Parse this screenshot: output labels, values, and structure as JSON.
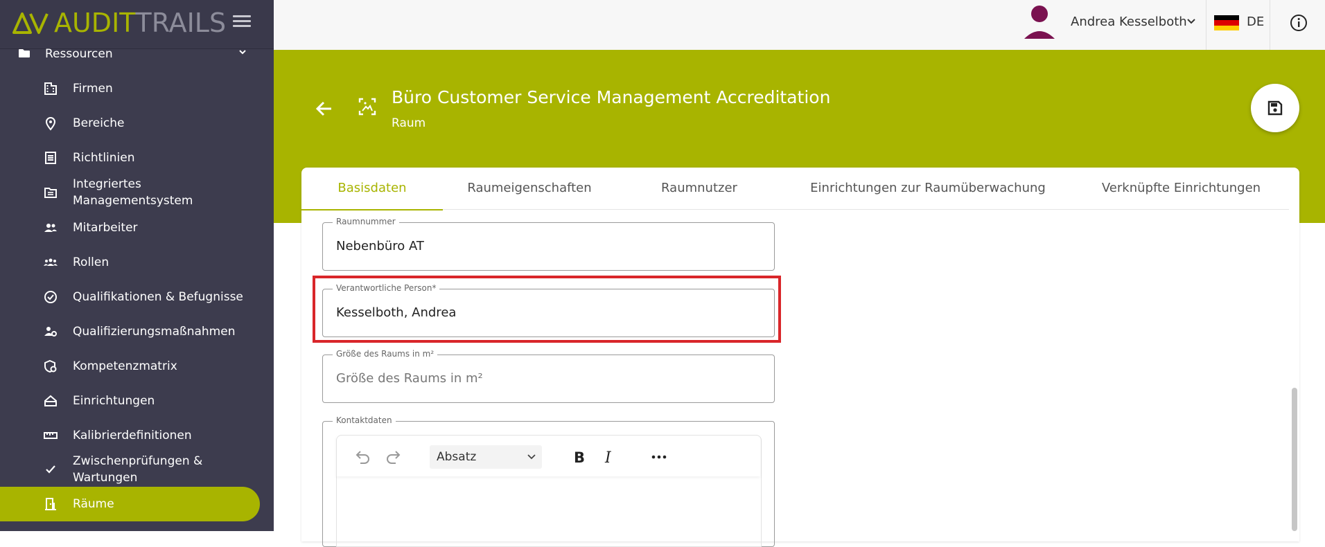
{
  "app": {
    "logo_part1": "AUDIT",
    "logo_part2": "TRAILS",
    "brand_color": "#a8b400",
    "sidebar_color": "#3d3c4e"
  },
  "sidebar": {
    "group": {
      "label": "Ressourcen",
      "icon": "folder-icon"
    },
    "items": [
      {
        "label": "Firmen",
        "icon": "building-icon"
      },
      {
        "label": "Bereiche",
        "icon": "location-pin-icon"
      },
      {
        "label": "Richtlinien",
        "icon": "document-list-icon"
      },
      {
        "label": "Integriertes Managementsystem",
        "icon": "folder-list-icon"
      },
      {
        "label": "Mitarbeiter",
        "icon": "people-icon"
      },
      {
        "label": "Rollen",
        "icon": "groups-icon"
      },
      {
        "label": "Qualifikationen & Befugnisse",
        "icon": "verified-badge-icon"
      },
      {
        "label": "Qualifizierungsmaßnahmen",
        "icon": "person-settings-icon"
      },
      {
        "label": "Kompetenzmatrix",
        "icon": "shield-matrix-icon"
      },
      {
        "label": "Einrichtungen",
        "icon": "house-icon"
      },
      {
        "label": "Kalibrierdefinitionen",
        "icon": "ruler-icon"
      },
      {
        "label": "Zwischenprüfungen & Wartungen",
        "icon": "check-icon"
      },
      {
        "label": "Räume",
        "icon": "door-icon",
        "active": true
      }
    ]
  },
  "topbar": {
    "user_name": "Andrea Kesselboth",
    "language": "DE"
  },
  "header": {
    "title": "Büro Customer Service Management Accreditation",
    "subtitle": "Raum"
  },
  "tabs": [
    {
      "label": "Basisdaten",
      "active": true
    },
    {
      "label": "Raumeigenschaften"
    },
    {
      "label": "Raumnutzer"
    },
    {
      "label": "Einrichtungen zur Raumüberwachung"
    },
    {
      "label": "Verknüpfte Einrichtungen"
    }
  ],
  "form": {
    "room_number": {
      "label": "Raumnummer",
      "value": "Nebenbüro AT"
    },
    "responsible_person": {
      "label": "Verantwortliche Person*",
      "value": "Kesselboth, Andrea"
    },
    "room_size": {
      "label": "Größe des Raums in m²",
      "placeholder": "Größe des Raums in m²"
    },
    "contact": {
      "label": "Kontaktdaten"
    }
  },
  "editor": {
    "paragraph_style": "Absatz"
  }
}
